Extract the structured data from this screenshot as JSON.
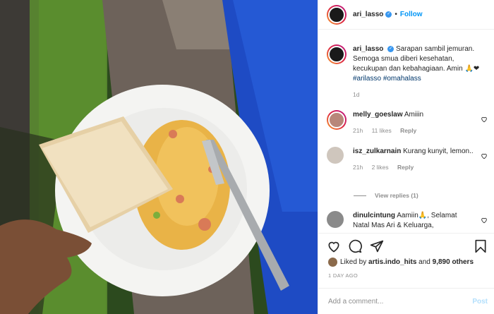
{
  "header": {
    "username": "ari_lasso",
    "verified_badge": "✓",
    "separator": "•",
    "follow_label": "Follow"
  },
  "caption": {
    "username": "ari_lasso",
    "verified_badge": "✓",
    "text": "Sarapan sambil jemuran. Semoga smua diberi kesehatan, kecukupan dan kebahagiaan. Amin 🙏❤",
    "hashtag1": "#arilasso",
    "hashtag2": "#omahalass",
    "time": "1d"
  },
  "comments": [
    {
      "username": "melly_goeslaw",
      "text": "Amiiin",
      "time": "21h",
      "likes": "11 likes",
      "reply": "Reply"
    },
    {
      "username": "isz_zulkarnain",
      "text": "Kurang kunyit, lemon..",
      "time": "21h",
      "likes": "2 likes",
      "reply": "Reply",
      "view_replies": "View replies (1)"
    },
    {
      "username": "dinulcintung",
      "text": "Aamiin🙏, Selamat Natal Mas Ari & Keluarga,"
    }
  ],
  "likes_line": {
    "prefix": "Liked by",
    "user": "artis.indo_hits",
    "middle": "and",
    "count": "9,890 others"
  },
  "post_time": "1 DAY AGO",
  "comment_box": {
    "placeholder": "Add a comment...",
    "post_label": "Post"
  },
  "icons": [
    "heart-icon",
    "comment-icon",
    "share-icon",
    "bookmark-icon"
  ]
}
